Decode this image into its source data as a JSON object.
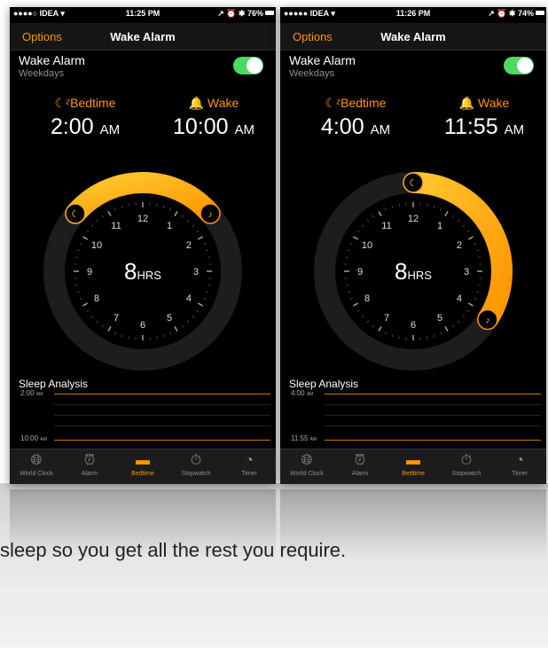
{
  "caption": "sleep so you get all the rest you require.",
  "left": {
    "status": {
      "carrier": "●●●●○ IDEA ▾",
      "time": "11:25 PM",
      "right": "↗ ⏰ ✱ 76%"
    },
    "nav": {
      "options": "Options",
      "title": "Wake Alarm"
    },
    "alarm": {
      "title": "Wake Alarm",
      "subtitle": "Weekdays",
      "enabled": true
    },
    "bedtime": {
      "label": "Bedtime",
      "time": "2:00",
      "ampm": "AM"
    },
    "wake": {
      "label": "Wake",
      "time": "10:00",
      "ampm": "AM"
    },
    "duration": {
      "value": "8",
      "unit": "HRS"
    },
    "sleep": {
      "title": "Sleep Analysis",
      "start": "2:00",
      "start_ampm": "AM",
      "end": "10:00",
      "end_ampm": "AM"
    },
    "tabs": [
      "World Clock",
      "Alarm",
      "Bedtime",
      "Stopwatch",
      "Timer"
    ]
  },
  "right": {
    "status": {
      "carrier": "●●●●● IDEA ▾",
      "time": "11:26 PM",
      "right": "↗ ⏰ ✱ 74%"
    },
    "nav": {
      "options": "Options",
      "title": "Wake Alarm"
    },
    "alarm": {
      "title": "Wake Alarm",
      "subtitle": "Weekdays",
      "enabled": true
    },
    "bedtime": {
      "label": "Bedtime",
      "time": "4:00",
      "ampm": "AM"
    },
    "wake": {
      "label": "Wake",
      "time": "11:55",
      "ampm": "AM"
    },
    "duration": {
      "value": "8",
      "unit": "HRS"
    },
    "sleep": {
      "title": "Sleep Analysis",
      "start": "4:00",
      "start_ampm": "AM",
      "end": "11:55",
      "end_ampm": "AM"
    },
    "tabs": [
      "World Clock",
      "Alarm",
      "Bedtime",
      "Stopwatch",
      "Timer"
    ]
  },
  "colors": {
    "accent": "#ff9500",
    "ring_start": "#ffc62e",
    "ring_end": "#ff9500",
    "toggle_on": "#4cd964"
  },
  "icons": {
    "bedtime": "moon-zzz-icon",
    "wake": "bell-icon",
    "tabs": [
      "globe-icon",
      "alarm-clock-icon",
      "bed-icon",
      "stopwatch-icon",
      "timer-icon"
    ]
  },
  "dials": {
    "left": {
      "bed_hour": 10.35,
      "wake_hour": 1.65
    },
    "right": {
      "bed_hour": 0.0,
      "wake_hour": 4.1
    }
  },
  "clock_numbers": [
    "12",
    "1",
    "2",
    "3",
    "4",
    "5",
    "6",
    "7",
    "8",
    "9",
    "10",
    "11"
  ]
}
